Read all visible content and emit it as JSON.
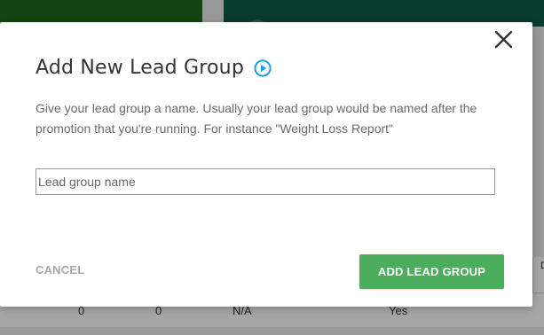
{
  "background": {
    "table_cells": [
      "0",
      "0",
      "N/A",
      "Yes"
    ],
    "right_edge_char": "D"
  },
  "modal": {
    "title": "Add New Lead Group",
    "description": "Give your lead group a name. Usually your lead group would be named after the promotion that you're running. For instance \"Weight Loss Report\"",
    "input": {
      "placeholder": "Lead group name",
      "value": ""
    },
    "cancel_label": "CANCEL",
    "add_label": "ADD LEAD GROUP",
    "icons": {
      "close": "close-icon",
      "play": "play-circle-icon"
    },
    "colors": {
      "accent_blue": "#1a9be6",
      "primary_green": "#4cae5c"
    }
  }
}
